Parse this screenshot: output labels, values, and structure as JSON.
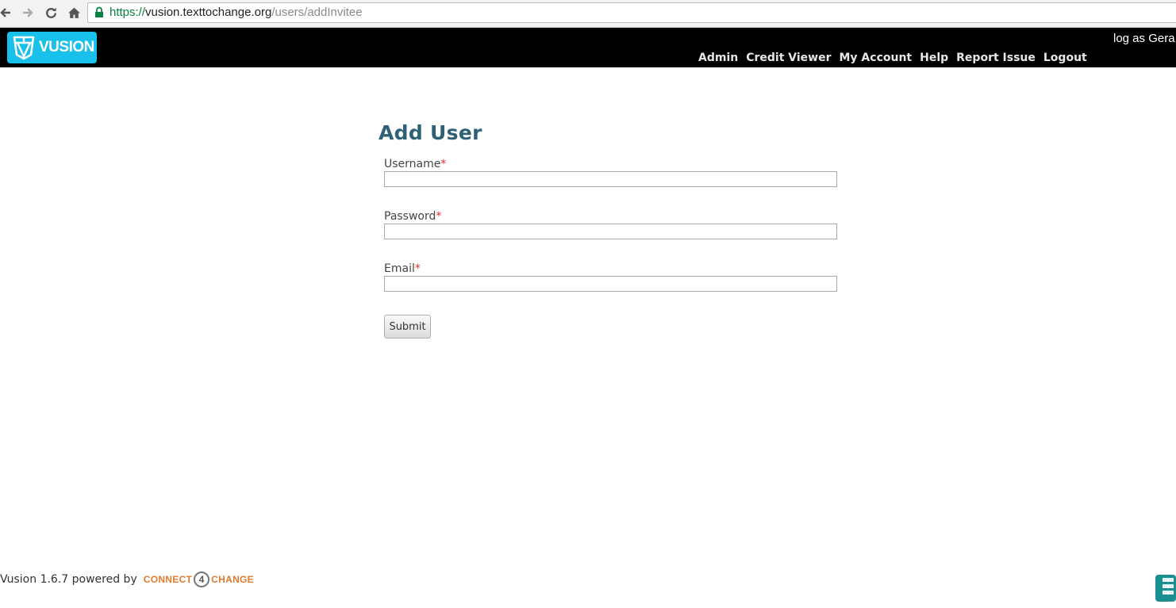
{
  "browser": {
    "url_scheme": "https://",
    "url_host": "vusion.texttochange.org",
    "url_path": "/users/addInvitee"
  },
  "header": {
    "logo_text": "VUSION",
    "login_info": "log as Gera",
    "nav": [
      "Admin",
      "Credit Viewer",
      "My Account",
      "Help",
      "Report Issue",
      "Logout"
    ]
  },
  "form": {
    "title": "Add User",
    "required_marker": "*",
    "fields": [
      {
        "label": "Username",
        "value": ""
      },
      {
        "label": "Password",
        "value": ""
      },
      {
        "label": "Email",
        "value": ""
      }
    ],
    "submit_label": "Submit"
  },
  "footer": {
    "text": "Vusion 1.6.7 powered by",
    "brand_part1": "CONNECT",
    "brand_number": "4",
    "brand_part2": "CHANGE"
  },
  "colors": {
    "logo_bg": "#19c1ea",
    "title": "#2e6176",
    "brand_orange": "#e07b2e",
    "required": "#d9302c"
  }
}
